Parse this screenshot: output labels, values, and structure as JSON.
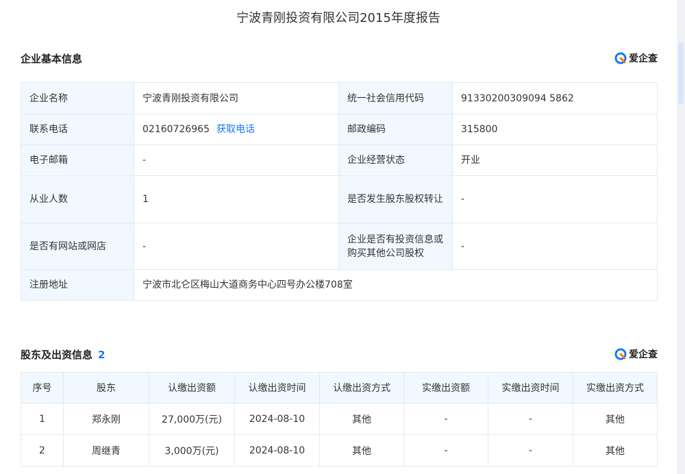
{
  "report": {
    "title": "宁波青刚投资有限公司2015年度报告"
  },
  "brand": {
    "name": "爱企查",
    "color": "#1677ff",
    "accent": "#ff7a00"
  },
  "basic_info": {
    "title": "企业基本信息",
    "rows": [
      {
        "l1": "企业名称",
        "v1": "宁波青刚投资有限公司",
        "l2": "统一社会信用代码",
        "v2": "91330200309094 5862"
      },
      {
        "l1": "联系电话",
        "v1": "02160726965",
        "link": "获取电话",
        "l2": "邮政编码",
        "v2": "315800"
      },
      {
        "l1": "电子邮箱",
        "v1": "-",
        "l2": "企业经营状态",
        "v2": "开业"
      },
      {
        "l1": "从业人数",
        "v1": "1",
        "l2": "是否发生股东股权转让",
        "v2": "-"
      },
      {
        "l1": "是否有网站或网店",
        "v1": "-",
        "l2": "企业是否有投资信息或购买其他公司股权",
        "v2": "-"
      },
      {
        "l1": "注册地址",
        "v1": "宁波市北仑区梅山大道商务中心四号办公楼708室"
      }
    ]
  },
  "shareholders": {
    "title": "股东及出资信息",
    "count": "2",
    "headers": [
      "序号",
      "股东",
      "认缴出资额",
      "认缴出资时间",
      "认缴出资方式",
      "实缴出资额",
      "实缴出资时间",
      "实缴出资方式"
    ],
    "rows": [
      [
        "1",
        "郑永刚",
        "27,000万(元)",
        "2024-08-10",
        "其他",
        "-",
        "-",
        "其他"
      ],
      [
        "2",
        "周继青",
        "3,000万(元)",
        "2024-08-10",
        "其他",
        "-",
        "-",
        "其他"
      ]
    ]
  }
}
